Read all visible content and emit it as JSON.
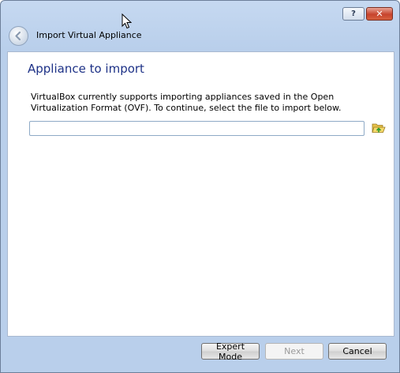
{
  "window": {
    "help_label": "?",
    "close_label": "✕"
  },
  "header": {
    "title": "Import Virtual Appliance"
  },
  "page": {
    "heading": "Appliance to import",
    "description": "VirtualBox currently supports importing appliances saved in the Open Virtualization Format (OVF). To continue, select the file to import below.",
    "file_input": {
      "value": "",
      "placeholder": ""
    }
  },
  "footer": {
    "expert_mode_label": "Expert Mode",
    "next_label": "Next",
    "cancel_label": "Cancel"
  },
  "icons": {
    "back": "back-arrow-icon",
    "folder": "open-folder-icon",
    "cursor": "mouse-pointer-icon"
  },
  "colors": {
    "heading": "#1e3287",
    "frame": "#b9cfeb",
    "close_button": "#c7432d"
  }
}
